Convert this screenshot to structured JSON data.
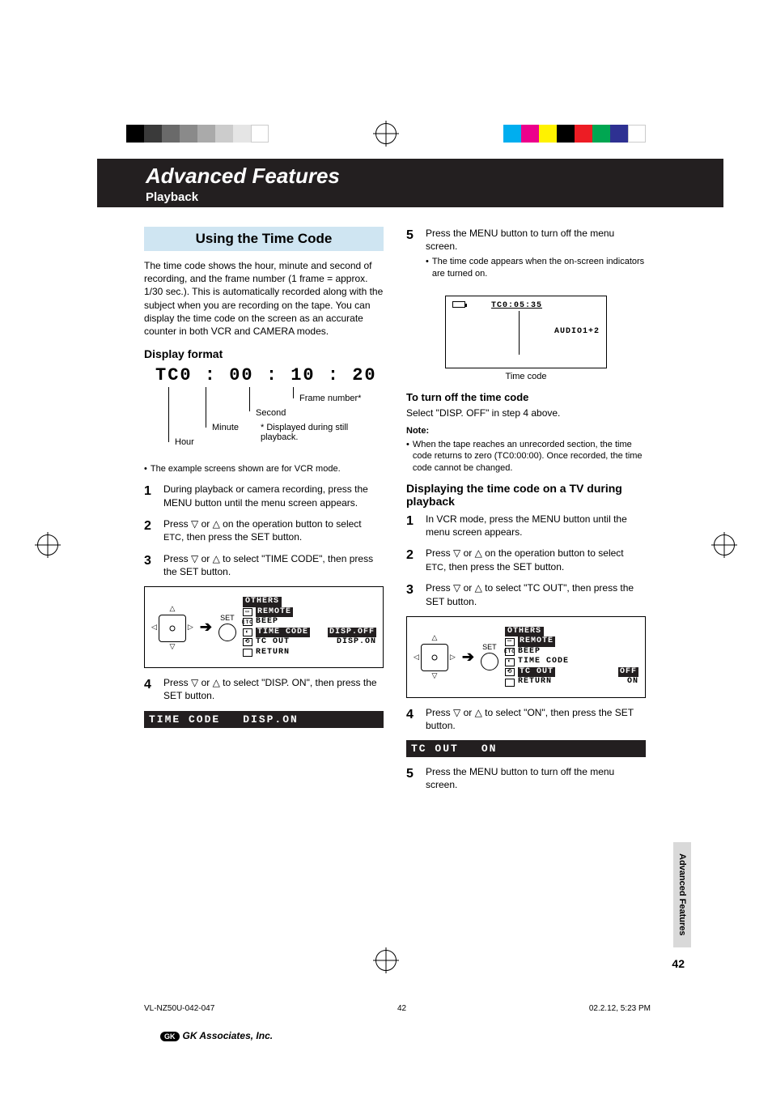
{
  "header": {
    "title": "Advanced Features",
    "subtitle": "Playback"
  },
  "section_title": "Using the Time Code",
  "intro": "The time code shows the hour, minute and second of recording, and the frame number (1 frame = approx. 1/30 sec.). This is automatically recorded along with the subject when you are recording on the tape. You can display the time code on the screen as an accurate counter in both VCR and CAMERA modes.",
  "display_format_heading": "Display format",
  "tc_sample": "TC0 : 00 : 10 : 20",
  "tc_labels": {
    "hour": "Hour",
    "minute": "Minute",
    "second": "Second",
    "frame": "Frame number*",
    "frame_note": "* Displayed during still playback."
  },
  "example_note": "The example screens shown are for VCR mode.",
  "left_steps": {
    "s1": "During playback or camera recording, press the MENU button until the menu screen appears.",
    "s2_a": "Press ",
    "s2_b": " or ",
    "s2_c": " on the operation button to select ",
    "s2_d": ", then press the SET button.",
    "etc": "ETC",
    "s3_a": "Press ",
    "s3_b": " or ",
    "s3_c": " to select \"TIME CODE\", then press the SET button.",
    "s4_a": "Press ",
    "s4_b": " or ",
    "s4_c": " to select \"DISP. ON\", then press the SET button."
  },
  "osd_left": {
    "title": "OTHERS",
    "remote": "REMOTE",
    "beep": "BEEP",
    "timecode": "TIME CODE",
    "tcout": "TC OUT",
    "return": "RETURN",
    "disp_off": "DISP.OFF",
    "disp_on": "DISP.ON"
  },
  "strip_left": {
    "label": "TIME CODE",
    "value": "DISP.ON"
  },
  "right_steps_a": {
    "s5_a": "Press the MENU button to turn off the menu screen.",
    "s5_b": "The time code appears when the on-screen indicators are turned on."
  },
  "screen": {
    "tc": "TC0:05:35",
    "audio": "AUDIO1+2",
    "caption": "Time code"
  },
  "turn_off_heading": "To turn off the time code",
  "turn_off_text": "Select \"DISP. OFF\" in step 4 above.",
  "note_heading": "Note:",
  "note_text": "When the tape reaches an unrecorded section, the time code returns to zero (TC0:00:00). Once recorded, the time code cannot be changed.",
  "tv_heading": "Displaying the time code on a TV during playback",
  "right_steps_b": {
    "s1": "In VCR mode, press the MENU button until the menu screen appears.",
    "s2_a": "Press ",
    "s2_b": " or ",
    "s2_c": " on the operation button to select ",
    "s2_d": ", then press the SET button.",
    "s3_a": "Press ",
    "s3_b": " or ",
    "s3_c": " to select \"TC OUT\", then press the SET button.",
    "s4_a": "Press ",
    "s4_b": " or ",
    "s4_c": " to select \"ON\", then press the SET button.",
    "s5": "Press the MENU button to turn off the menu screen."
  },
  "osd_right": {
    "title": "OTHERS",
    "remote": "REMOTE",
    "beep": "BEEP",
    "timecode": "TIME CODE",
    "tcout": "TC OUT",
    "return": "RETURN",
    "off": "OFF",
    "on": "ON"
  },
  "strip_right": {
    "label": "TC OUT",
    "value": "ON"
  },
  "side_tab": "Advanced Features",
  "page_number": "42",
  "footer": {
    "file": "VL-NZ50U-042-047",
    "page": "42",
    "timestamp": "02.2.12, 5:23 PM"
  },
  "gk": "GK Associates, Inc.",
  "joy_label": "SET",
  "glyph": {
    "down": "▽",
    "up": "△"
  }
}
